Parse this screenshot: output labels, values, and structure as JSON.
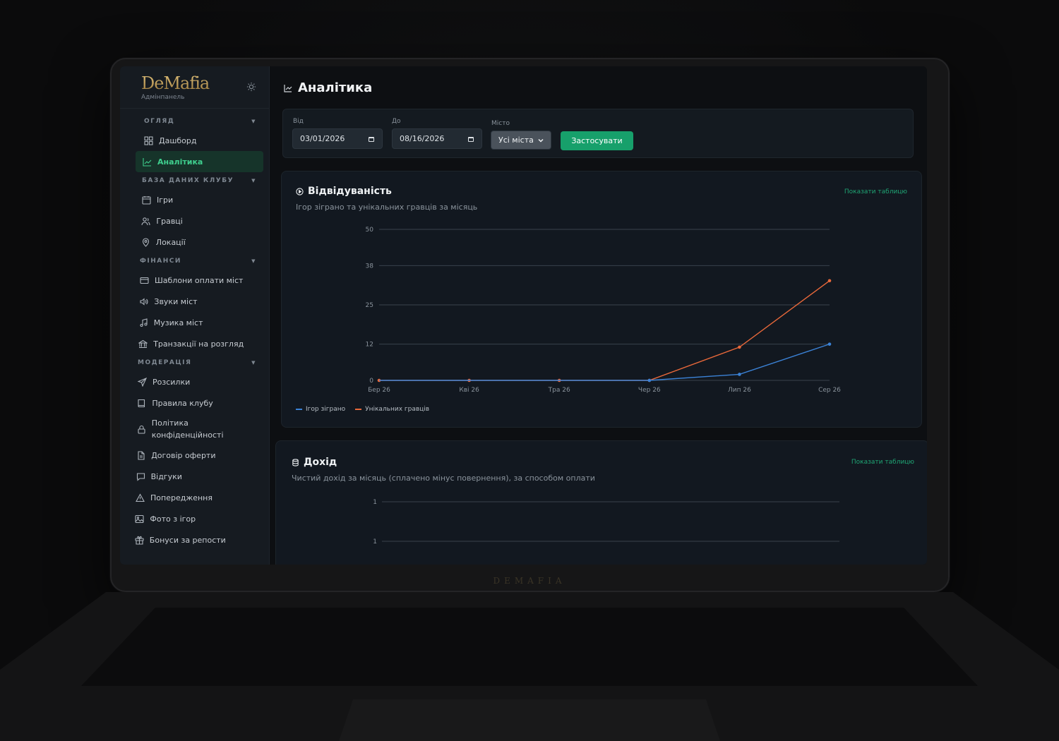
{
  "brand": {
    "logo": "DeMafia",
    "subtitle": "Адмінпанель",
    "lid_mark": "DEMAFIA"
  },
  "sidebar": {
    "sections": [
      {
        "title": "ОГЛЯД",
        "items": [
          {
            "label": "Дашборд",
            "icon": "grid-icon"
          },
          {
            "label": "Аналітика",
            "icon": "chart-icon",
            "active": true
          }
        ]
      },
      {
        "title": "БАЗА ДАНИХ КЛУБУ",
        "items": [
          {
            "label": "Ігри",
            "icon": "calendar-icon"
          },
          {
            "label": "Гравці",
            "icon": "users-icon"
          },
          {
            "label": "Локації",
            "icon": "pin-icon"
          }
        ]
      },
      {
        "title": "ФІНАНСИ",
        "items": [
          {
            "label": "Шаблони оплати міст",
            "icon": "card-icon"
          },
          {
            "label": "Звуки міст",
            "icon": "speaker-icon"
          },
          {
            "label": "Музика міст",
            "icon": "music-icon"
          },
          {
            "label": "Транзакції на розгляд",
            "icon": "bank-icon"
          }
        ]
      },
      {
        "title": "МОДЕРАЦІЯ",
        "items": [
          {
            "label": "Розсилки",
            "icon": "send-icon"
          },
          {
            "label": "Правила клубу",
            "icon": "book-icon"
          },
          {
            "label": "Політика конфіденційності",
            "icon": "lock-icon"
          },
          {
            "label": "Договір оферти",
            "icon": "doc-icon"
          },
          {
            "label": "Відгуки",
            "icon": "message-icon"
          },
          {
            "label": "Попередження",
            "icon": "warning-icon"
          },
          {
            "label": "Фото з ігор",
            "icon": "image-icon"
          },
          {
            "label": "Бонуси за репости",
            "icon": "gift-icon"
          }
        ]
      }
    ]
  },
  "page": {
    "title": "Аналітика"
  },
  "filters": {
    "from_label": "Від",
    "from_value": "03/01/2026",
    "to_label": "До",
    "to_value": "08/16/2026",
    "city_label": "Місто",
    "city_value": "Усі міста",
    "apply_label": "Застосувати"
  },
  "attendance": {
    "title": "Відвідуваність",
    "subtitle": "Ігор зіграно та унікальних гравців за місяць",
    "link": "Показати таблицю"
  },
  "income": {
    "title": "Дохід",
    "subtitle": "Чистий дохід за місяць (сплачено мінус повернення), за способом оплати",
    "link": "Показати таблицю"
  },
  "colors": {
    "accent": "#17a06b",
    "series_games": "#3b82d6",
    "series_players": "#e8683a"
  },
  "chart_data": [
    {
      "type": "line",
      "title": "Відвідуваність",
      "categories": [
        "Бер 26",
        "Кві 26",
        "Тра 26",
        "Чер 26",
        "Лип 26",
        "Сер 26"
      ],
      "yticks": [
        "0",
        "12",
        "25",
        "38",
        "50"
      ],
      "ylim": [
        0,
        50
      ],
      "series": [
        {
          "name": "Ігор зіграно",
          "values": [
            0,
            0,
            0,
            0,
            2,
            12
          ]
        },
        {
          "name": "Унікальних гравців",
          "values": [
            0,
            0,
            0,
            0,
            11,
            33
          ]
        }
      ],
      "legend": "bottom-left",
      "grid": true
    },
    {
      "type": "line",
      "title": "Дохід",
      "yticks": [
        "1",
        "1"
      ],
      "series": [],
      "grid": true
    }
  ]
}
